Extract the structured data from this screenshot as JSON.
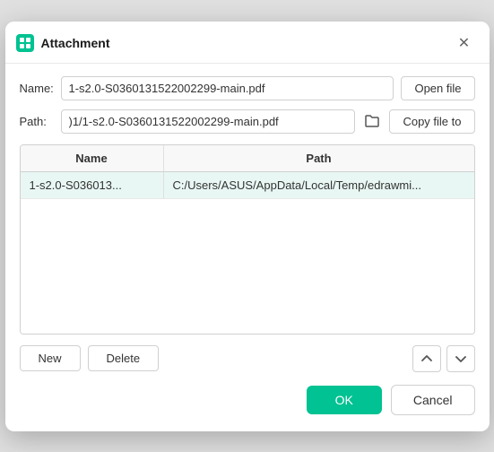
{
  "dialog": {
    "title": "Attachment",
    "app_icon_alt": "app-icon"
  },
  "fields": {
    "name_label": "Name:",
    "name_value": "1-s2.0-S0360131522002299-main.pdf",
    "open_file_label": "Open file",
    "path_label": "Path:",
    "path_value": ")1/1-s2.0-S0360131522002299-main.pdf",
    "copy_file_label": "Copy file to"
  },
  "table": {
    "col_name": "Name",
    "col_path": "Path",
    "rows": [
      {
        "name": "1-s2.0-S036013...",
        "path": "C:/Users/ASUS/AppData/Local/Temp/edrawmi..."
      }
    ]
  },
  "actions": {
    "new_label": "New",
    "delete_label": "Delete",
    "up_arrow": "↑",
    "down_arrow": "↓"
  },
  "footer": {
    "ok_label": "OK",
    "cancel_label": "Cancel"
  }
}
